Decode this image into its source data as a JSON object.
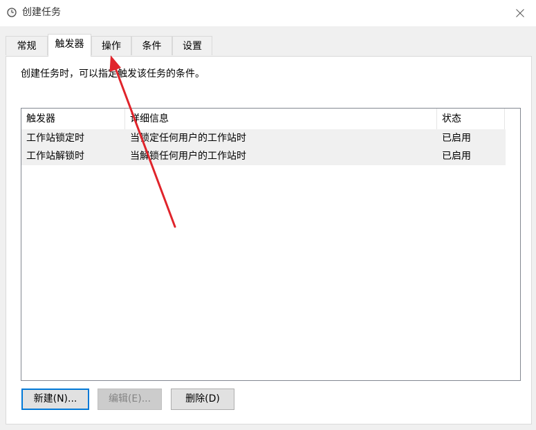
{
  "window": {
    "title": "创建任务",
    "close_glyph": "✕"
  },
  "tabs": [
    {
      "label": "常规",
      "active": false
    },
    {
      "label": "触发器",
      "active": true
    },
    {
      "label": "操作",
      "active": false
    },
    {
      "label": "条件",
      "active": false
    },
    {
      "label": "设置",
      "active": false
    }
  ],
  "panel": {
    "description": "创建任务时，可以指定触发该任务的条件。",
    "table": {
      "headers": [
        "触发器",
        "详细信息",
        "状态"
      ],
      "rows": [
        [
          "工作站锁定时",
          "当锁定任何用户的工作站时",
          "已启用"
        ],
        [
          "工作站解锁时",
          "当解锁任何用户的工作站时",
          "已启用"
        ]
      ]
    },
    "buttons": {
      "new": "新建(N)...",
      "edit": "编辑(E)...",
      "delete": "删除(D)"
    }
  },
  "annotation": {
    "arrow_color": "#e0242b"
  },
  "colors": {
    "accent": "#0078d7",
    "row_bg": "#f0f0f0",
    "disabled_text": "#838383"
  }
}
